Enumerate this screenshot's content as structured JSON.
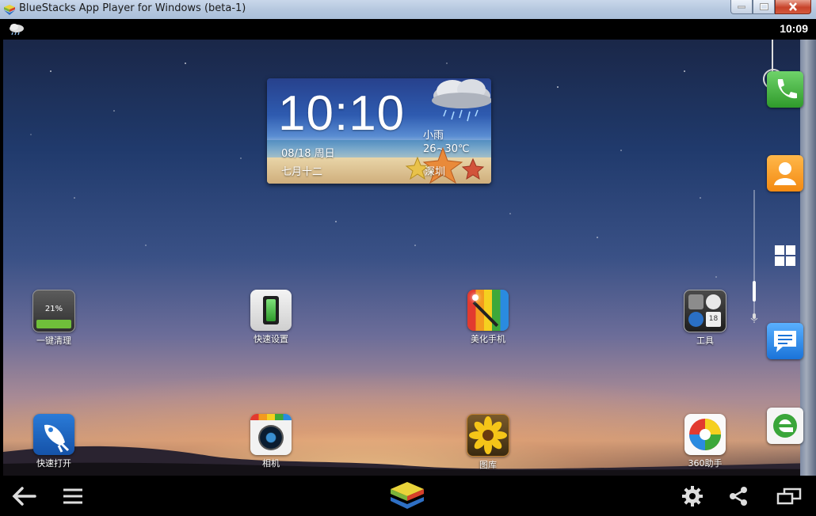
{
  "window": {
    "title": "BlueStacks App Player for Windows (beta-1)"
  },
  "statusbar": {
    "time": "10:09"
  },
  "weather_widget": {
    "time": "10:10",
    "date": "08/18   周日",
    "lunar_date": "七月十二",
    "condition": "小雨",
    "temperature": "26~30℃",
    "city": "深圳"
  },
  "apps": [
    {
      "id": "cleanup",
      "label": "一键清理",
      "badge": "21%",
      "icon": "memory-cleanup-icon",
      "level_percent": 21
    },
    {
      "id": "quick_settings",
      "label": "快速设置",
      "icon": "quick-settings-icon"
    },
    {
      "id": "beautify",
      "label": "美化手机",
      "icon": "beautify-phone-icon"
    },
    {
      "id": "tools",
      "label": "工具",
      "icon": "tools-folder-icon",
      "folder_badge": "18"
    },
    {
      "id": "quick_open",
      "label": "快速打开",
      "icon": "rocket-icon"
    },
    {
      "id": "camera",
      "label": "相机",
      "icon": "camera-icon"
    },
    {
      "id": "gallery",
      "label": "图库",
      "icon": "gallery-icon"
    },
    {
      "id": "assistant360",
      "label": "360助手",
      "icon": "360-assistant-icon"
    }
  ],
  "dock": [
    {
      "id": "phone",
      "icon": "phone-icon"
    },
    {
      "id": "contacts",
      "icon": "contacts-icon"
    },
    {
      "id": "windows",
      "icon": "windows-icon"
    },
    {
      "id": "messages",
      "icon": "messages-icon"
    },
    {
      "id": "browser",
      "icon": "browser-icon"
    }
  ],
  "colors": {
    "phone_green": "#3da83a",
    "contacts_orange": "#f39a1e",
    "messages_blue": "#2a8be0",
    "cleanup_green": "#6fbf3a"
  }
}
